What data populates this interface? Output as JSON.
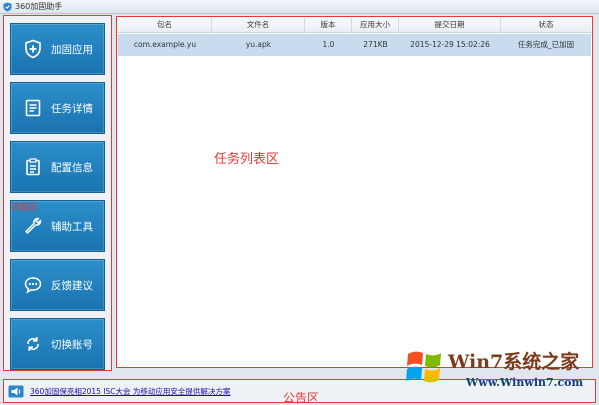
{
  "window": {
    "title": "360加固助手"
  },
  "sidebar": {
    "caption": "功能区",
    "items": [
      {
        "label": "加固应用",
        "icon": "shield-plus-icon"
      },
      {
        "label": "任务详情",
        "icon": "task-list-icon"
      },
      {
        "label": "配置信息",
        "icon": "clipboard-icon"
      },
      {
        "label": "辅助工具",
        "icon": "wrench-icon"
      },
      {
        "label": "反馈建议",
        "icon": "chat-bubble-icon"
      },
      {
        "label": "切换账号",
        "icon": "switch-account-icon"
      }
    ]
  },
  "task_list": {
    "caption": "任务列表区",
    "columns": [
      "包名",
      "文件名",
      "版本",
      "应用大小",
      "提交日期",
      "状态"
    ],
    "rows": [
      [
        "com.example.yu",
        "yu.apk",
        "1.0",
        "271KB",
        "2015-12-29 15:02:26",
        "任务完成_已加固"
      ]
    ]
  },
  "notice": {
    "caption": "公告区",
    "text": "360加固保亮相2015 ISC大会 为移动应用安全提供解决方案"
  },
  "watermark": {
    "title": "Win7系统之家",
    "url": "Www.Winwin7.com"
  },
  "colors": {
    "primary_blue": "#1f7dbc",
    "zone_border": "#e53935",
    "selected_row": "#c9dcef",
    "link": "#1a0dab"
  }
}
